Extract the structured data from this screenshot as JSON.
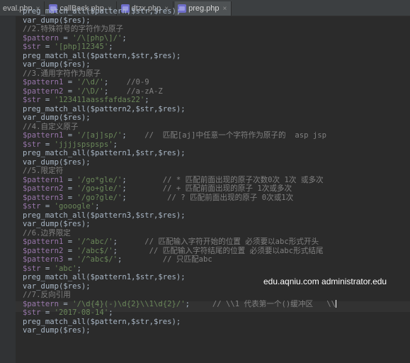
{
  "tabs": [
    {
      "label": "eval.php",
      "active": false
    },
    {
      "label": "callBack.php",
      "active": false
    },
    {
      "label": "dtzx.php",
      "active": false
    },
    {
      "label": "preg.php",
      "active": true
    }
  ],
  "code_lines": [
    {
      "t": "plain",
      "s": "preg_match_all($pattern,$str,$res);"
    },
    {
      "t": "plain",
      "s": "var_dump($res);"
    },
    {
      "t": "cmt",
      "s": "//2.特殊符号的字符作为原子"
    },
    {
      "t": "assign",
      "v": "$pattern",
      "s": "'/\\[php\\]/'",
      "c": ""
    },
    {
      "t": "assign",
      "v": "$str",
      "s": "'[php]12345'",
      "c": ""
    },
    {
      "t": "plain",
      "s": "preg_match_all($pattern,$str,$res);"
    },
    {
      "t": "plain",
      "s": "var_dump($res);"
    },
    {
      "t": "cmt",
      "s": "//3.通用字符作为原子"
    },
    {
      "t": "assign",
      "v": "$pattern1",
      "s": "'/\\d/'",
      "c": "    //0-9"
    },
    {
      "t": "assign",
      "v": "$pattern2",
      "s": "'/\\D/'",
      "c": "    //a-zA-Z"
    },
    {
      "t": "assign",
      "v": "$str",
      "s": "'123411aassfafdas22'",
      "c": ""
    },
    {
      "t": "plain",
      "s": "preg_match_all($pattern2,$str,$res);"
    },
    {
      "t": "plain",
      "s": "var_dump($res);"
    },
    {
      "t": "cmt",
      "s": "//4.自定义原子"
    },
    {
      "t": "assign",
      "v": "$pattern1",
      "s": "'/[aj]sp/'",
      "c": "    //  匹配[aj]中任意一个字符作为原子的  asp jsp"
    },
    {
      "t": "assign",
      "v": "$str",
      "s": "'jjjjspspsps'",
      "c": ""
    },
    {
      "t": "plain",
      "s": "preg_match_all($pattern1,$str,$res);"
    },
    {
      "t": "plain",
      "s": "var_dump($res);"
    },
    {
      "t": "cmt",
      "s": "//5.限定符"
    },
    {
      "t": "assign",
      "v": "$pattern1",
      "s": "'/go*gle/'",
      "c": "        // * 匹配前面出现的原子次数0次 1次 或多次"
    },
    {
      "t": "assign",
      "v": "$pattern2",
      "s": "'/go+gle/'",
      "c": "        // + 匹配前面出现的原子 1次或多次"
    },
    {
      "t": "assign",
      "v": "$pattern3",
      "s": "'/go?gle/'",
      "c": "         // ? 匹配前面出现的原子 0次或1次"
    },
    {
      "t": "assign",
      "v": "$str",
      "s": "'gooogle'",
      "c": ""
    },
    {
      "t": "plain",
      "s": "preg_match_all($pattern3,$str,$res);"
    },
    {
      "t": "plain",
      "s": "var_dump($res);"
    },
    {
      "t": "cmt",
      "s": "//6.边界限定"
    },
    {
      "t": "assign",
      "v": "$pattern1",
      "s": "'/^abc/'",
      "c": "      // 匹配输入字符开始的位置 必须要以abc形式开头"
    },
    {
      "t": "assign",
      "v": "$pattern2",
      "s": "'/abc$/'",
      "c": "       // 匹配输入字符结尾的位置 必须要以abc形式结尾"
    },
    {
      "t": "assign",
      "v": "$pattern3",
      "s": "'/^abc$/'",
      "c": "         // 只匹配abc"
    },
    {
      "t": "assign",
      "v": "$str",
      "s": "'abc'",
      "c": ""
    },
    {
      "t": "plain",
      "s": "preg_match_all($pattern1,$str,$res);"
    },
    {
      "t": "plain",
      "s": "var_dump($res);"
    },
    {
      "t": "cmt",
      "s": "//7.反向引用"
    },
    {
      "t": "assign",
      "v": "$pattern",
      "s": "'/\\d{4}(-)\\d{2}\\\\1\\d{2}/'",
      "c": "     // \\\\1 代表第一个()缓冲区   \\\\"
    },
    {
      "t": "assign",
      "v": "$str",
      "s": "'2017-08-14'",
      "c": ""
    },
    {
      "t": "plain",
      "s": "preg_match_all($pattern,$str,$res);"
    },
    {
      "t": "plain",
      "s": "var_dump($res);"
    }
  ],
  "watermark": "edu.aqniu.com administrator.edu"
}
